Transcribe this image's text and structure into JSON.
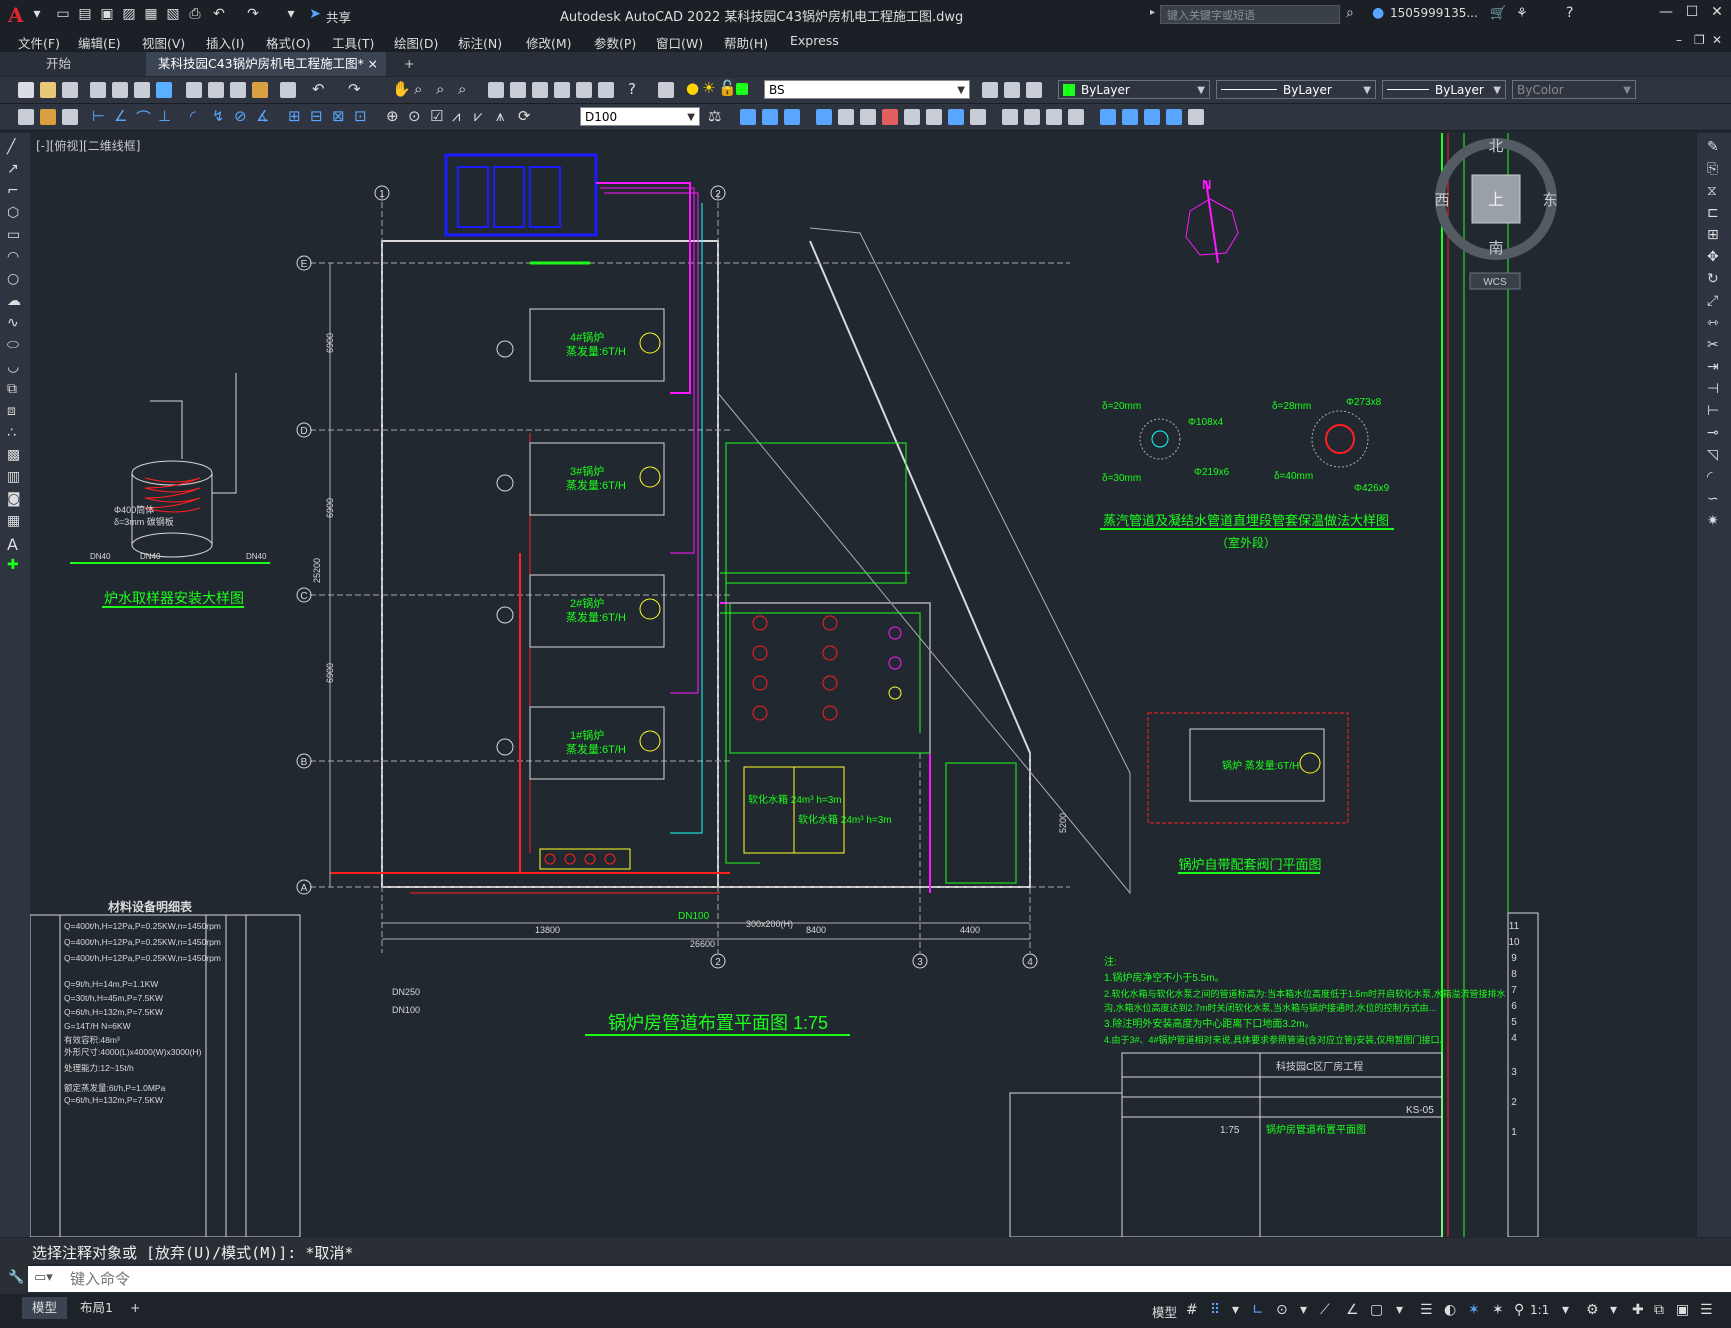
{
  "app": {
    "title": "Autodesk AutoCAD 2022    某科技园C43锅炉房机电工程施工图.dwg",
    "share": "共享",
    "search_placeholder": "键入关键字或短语",
    "user": "1505999135...",
    "logo": "A"
  },
  "menu": [
    "文件(F)",
    "编辑(E)",
    "视图(V)",
    "插入(I)",
    "格式(O)",
    "工具(T)",
    "绘图(D)",
    "标注(N)",
    "修改(M)",
    "参数(P)",
    "窗口(W)",
    "帮助(H)",
    "Express"
  ],
  "tabs": {
    "start": "开始",
    "file": "某科技园C43锅炉房机电工程施工图*",
    "close": "×",
    "new": "+"
  },
  "toolbar": {
    "layer": "BS",
    "color": "ByLayer",
    "linetype": "ByLayer",
    "lineweight": "ByLayer",
    "plotstyle": "ByColor",
    "dimstyle": "D100"
  },
  "viewport": {
    "label": "[-][俯视][二维线框]"
  },
  "viewcube": {
    "n": "北",
    "s": "南",
    "e": "东",
    "w": "西",
    "top": "上",
    "wcs": "WCS"
  },
  "drawing": {
    "main_title": "锅炉房管道布置平面图  1:75",
    "sample_title": "炉水取样器安装大样图",
    "sleeve_title": "蒸汽管道及凝结水管道直埋段管套保温做法大样图",
    "sleeve_sub": "（室外段）",
    "valve_title": "锅炉自带配套阀门平面图",
    "table_title": "材料设备明细表",
    "north": "N",
    "boiler_labels": [
      "4#锅炉",
      "3#锅炉",
      "2#锅炉",
      "1#锅炉"
    ],
    "boiler_cap": "蒸发量:6T/H",
    "side_boiler": "锅炉\n蒸发量:6T/H",
    "grid_rows": [
      "E",
      "D",
      "C",
      "B",
      "A"
    ],
    "grid_cols": [
      "1",
      "2",
      "3",
      "4"
    ],
    "dims": {
      "d1": "13800",
      "d2": "8400",
      "d3": "4400",
      "total": "26600",
      "left": "25200",
      "d4": "6900",
      "d5": "6900",
      "d6": "6900",
      "d7": "5200",
      "tank_dim": "300x200(H)"
    },
    "pipe_dn": {
      "dn250": "DN250",
      "dn100": "DN100",
      "dn400": "DN400"
    },
    "tanks": [
      "软化水箱 24m³ h=3m",
      "软化水箱 24m³ h=3m"
    ],
    "sleeve_dims": [
      "δ=20mm",
      "Φ108x4",
      "δ=30mm",
      "Φ219x6",
      "δ=28mm",
      "Φ273x8",
      "δ=40mm",
      "Φ426x9"
    ],
    "sample_text": [
      "Φ400筒体",
      "δ=3mm 碳钢板",
      "DN40",
      "DN40",
      "DN40"
    ],
    "notes_title": "注:",
    "notes": [
      "1.锅炉房净空不小于5.5m。",
      "2.软化水箱与软化水泵之间的管道标高为:当本箱水位高度低于1.5m时开启软化水泵,水箱溢流管接排水",
      "  沟,水箱水位高度达到2.7m时关闭软化水泵,当水箱与锅炉接通时,水位的控制方式由...",
      "3.除注明外安装高度为中心距离下口地面3.2m。",
      "4.由于3#、4#锅炉管道相对来说,具体要求参照管道(含对应立管)安装,仅用暂图门接口。"
    ],
    "titleblock": {
      "project": "科技园C区厂房工程",
      "sheet": "KS-05",
      "scale": "1:75",
      "name": "锅炉房管道布置平面图"
    },
    "table_rows": [
      "Q=400t/h,H=12Pa,P=0.25KW,n=1450rpm",
      "Q=400t/h,H=12Pa,P=0.25KW,n=1450rpm",
      "Q=400t/h,H=12Pa,P=0.25KW,n=1450rpm",
      "Q=9t/h,H=14m,P=1.1KW",
      "Q=30t/h,H=45m,P=7.5KW",
      "Q=6t/h,H=132m,P=7.5KW",
      "G=14T/H N=6KW",
      "有效容积:48m³",
      "外形尺寸:4000(L)x4000(W)x3000(H)",
      "处理能力:12~15t/h",
      "额定蒸发量:6t/h,P=1.0MPa",
      "Q=6t/h,H=132m,P=7.5KW"
    ],
    "right_table_nums": [
      "11",
      "10",
      "9",
      "8",
      "7",
      "6",
      "5",
      "4",
      "3",
      "2",
      "1"
    ]
  },
  "command": {
    "history": "选择注释对象或 [放弃(U)/模式(M)]: *取消*",
    "placeholder": "键入命令"
  },
  "status": {
    "model_tab": "模型",
    "layout_tab": "布局1",
    "add": "+",
    "model_btn": "模型",
    "scale": "1:1"
  },
  "colors": {
    "bg": "#212830",
    "green": "#1bff1b",
    "magenta": "#ff19ff",
    "red": "#ff2020",
    "yellow": "#ffff24",
    "cyan": "#18ffff",
    "blue": "#1b1bff",
    "white": "#d8d8d8"
  }
}
